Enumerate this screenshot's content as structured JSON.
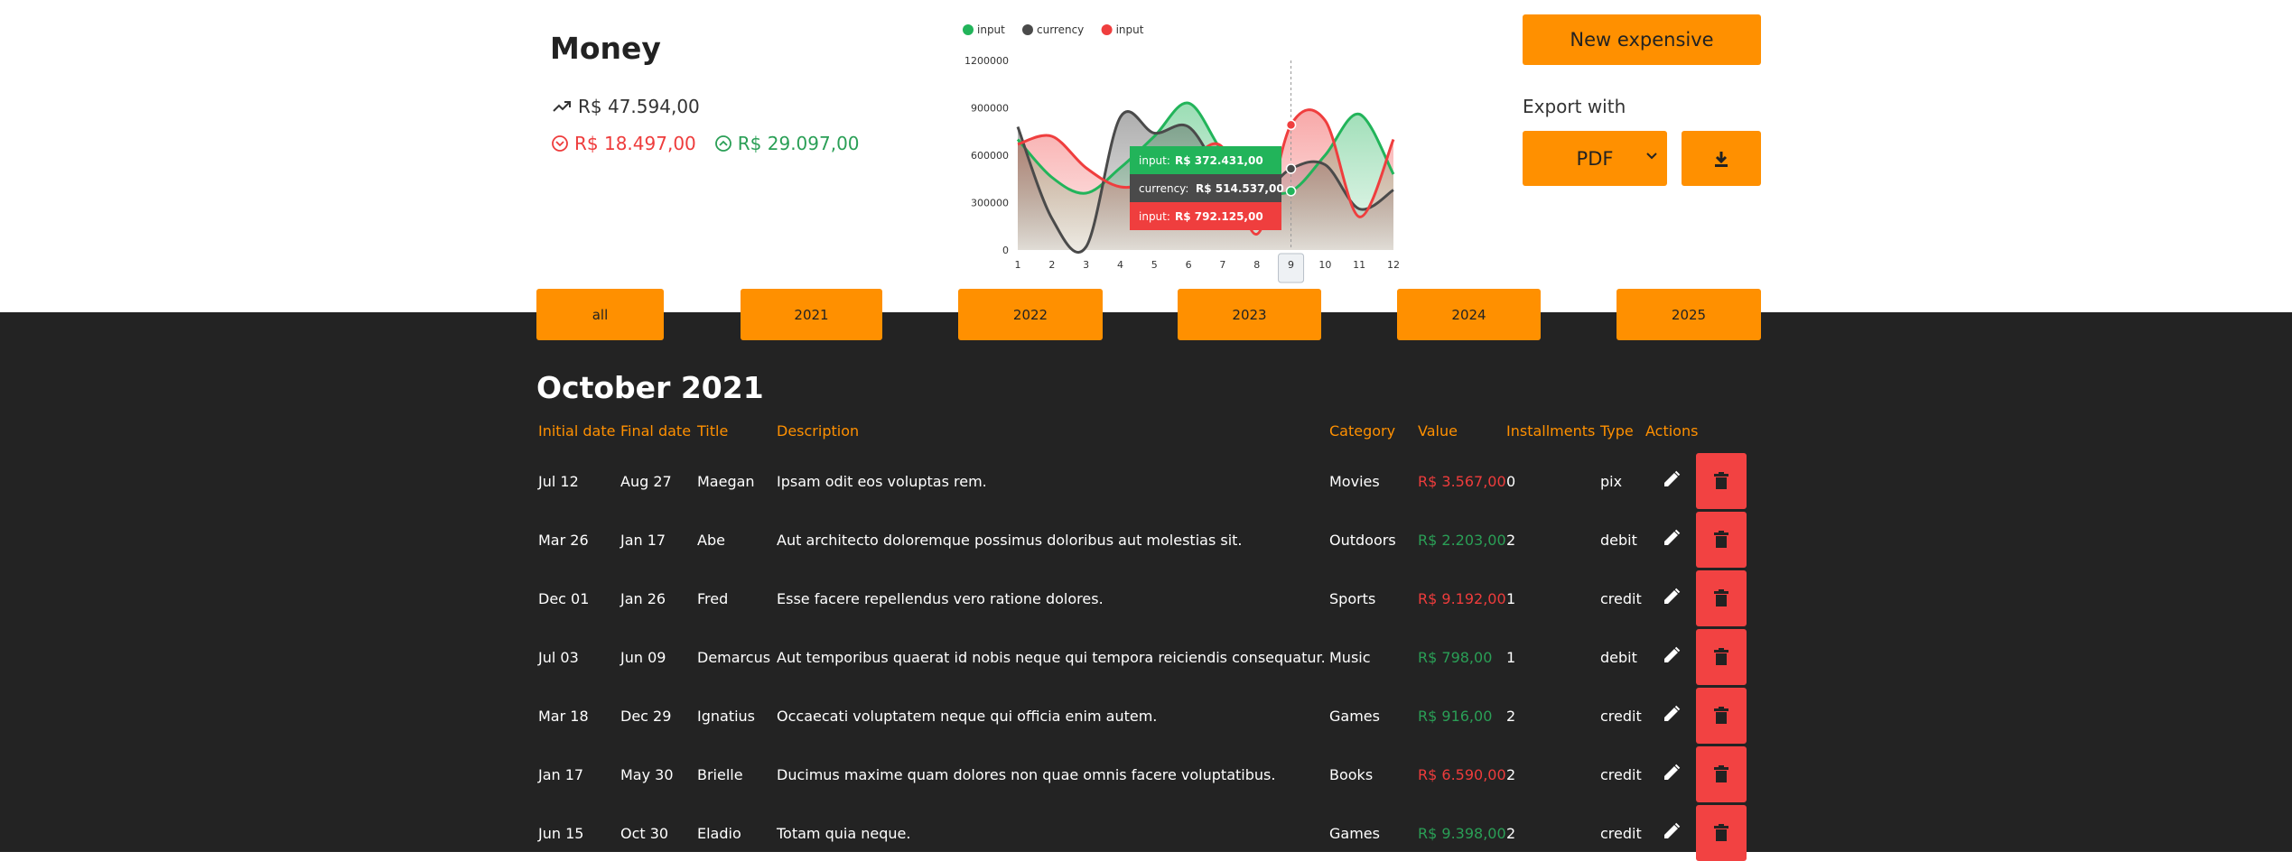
{
  "header": {
    "title": "Money",
    "total": "R$ 47.594,00",
    "negative": "R$ 18.497,00",
    "positive": "R$ 29.097,00"
  },
  "actions": {
    "new_label": "New expensive",
    "export_label": "Export with",
    "export_format": "PDF"
  },
  "years": [
    "all",
    "2021",
    "2022",
    "2023",
    "2024",
    "2025"
  ],
  "month_title": "October 2021",
  "columns": [
    "Initial date",
    "Final date",
    "Title",
    "Description",
    "Category",
    "Value",
    "Installments",
    "Type",
    "Actions"
  ],
  "rows": [
    {
      "initial": "Jul 12",
      "final": "Aug 27",
      "title": "Maegan",
      "description": "Ipsam odit eos voluptas rem.",
      "category": "Movies",
      "value": "R$ 3.567,00",
      "value_sign": "negative",
      "installments": "0",
      "type": "pix"
    },
    {
      "initial": "Mar 26",
      "final": "Jan 17",
      "title": "Abe",
      "description": "Aut architecto doloremque possimus doloribus aut molestias sit.",
      "category": "Outdoors",
      "value": "R$ 2.203,00",
      "value_sign": "positive",
      "installments": "2",
      "type": "debit"
    },
    {
      "initial": "Dec 01",
      "final": "Jan 26",
      "title": "Fred",
      "description": "Esse facere repellendus vero ratione dolores.",
      "category": "Sports",
      "value": "R$ 9.192,00",
      "value_sign": "negative",
      "installments": "1",
      "type": "credit"
    },
    {
      "initial": "Jul 03",
      "final": "Jun 09",
      "title": "Demarcus",
      "description": "Aut temporibus quaerat id nobis neque qui tempora reiciendis consequatur.",
      "category": "Music",
      "value": "R$ 798,00",
      "value_sign": "positive",
      "installments": "1",
      "type": "debit"
    },
    {
      "initial": "Mar 18",
      "final": "Dec 29",
      "title": "Ignatius",
      "description": "Occaecati voluptatem neque qui officia enim autem.",
      "category": "Games",
      "value": "R$ 916,00",
      "value_sign": "positive",
      "installments": "2",
      "type": "credit"
    },
    {
      "initial": "Jan 17",
      "final": "May 30",
      "title": "Brielle",
      "description": "Ducimus maxime quam dolores non quae omnis facere voluptatibus.",
      "category": "Books",
      "value": "R$ 6.590,00",
      "value_sign": "negative",
      "installments": "2",
      "type": "credit"
    },
    {
      "initial": "Jun 15",
      "final": "Oct 30",
      "title": "Eladio",
      "description": "Totam quia neque.",
      "category": "Games",
      "value": "R$ 9.398,00",
      "value_sign": "positive",
      "installments": "2",
      "type": "credit"
    }
  ],
  "colors": {
    "accent": "#ff9000",
    "negative": "#ee3c3c",
    "positive": "#2a9f56",
    "dark_bg": "#232323",
    "currency": "#4a4a4a"
  },
  "chart_data": {
    "type": "area",
    "x": [
      1,
      2,
      3,
      4,
      5,
      6,
      7,
      8,
      9,
      10,
      11,
      12
    ],
    "ylim": [
      0,
      1200000
    ],
    "yticks": [
      "0",
      "300000",
      "600000",
      "900000",
      "1200000"
    ],
    "series": [
      {
        "name": "input",
        "color": "#22b45a",
        "values": [
          700000,
          460000,
          360000,
          520000,
          720000,
          930000,
          620000,
          400000,
          372431,
          600000,
          860000,
          480000
        ]
      },
      {
        "name": "currency",
        "color": "#4a4a4a",
        "values": [
          780000,
          200000,
          20000,
          840000,
          740000,
          780000,
          470000,
          340000,
          514537,
          540000,
          260000,
          380000
        ]
      },
      {
        "name": "input",
        "color": "#ef3e3e",
        "values": [
          670000,
          720000,
          520000,
          400000,
          440000,
          560000,
          650000,
          100000,
          792125,
          820000,
          210000,
          700000
        ]
      }
    ],
    "tooltip": {
      "x": 9,
      "items": [
        {
          "label": "input:",
          "value": "R$ 372.431,00"
        },
        {
          "label": "currency:",
          "value": "R$ 514.537,00"
        },
        {
          "label": "input:",
          "value": "R$ 792.125,00"
        }
      ]
    }
  }
}
